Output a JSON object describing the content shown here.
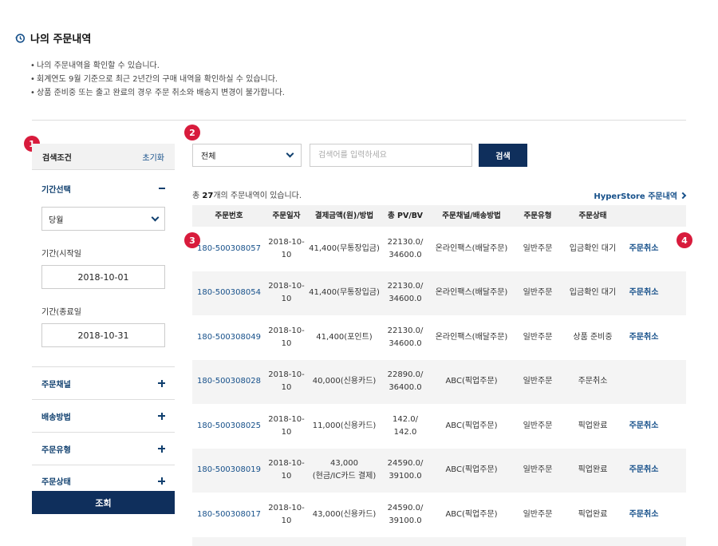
{
  "page": {
    "title": "나의 주문내역",
    "notes": [
      "나의 주문내역을 확인할 수 있습니다.",
      "회계연도 9월 기준으로 최근 2년간의 구매 내역을 확인하실 수 있습니다.",
      "상품 준비중 또는 출고 완료의 경우 주문 취소와 배송지 변경이 불가합니다."
    ]
  },
  "badges": [
    "1",
    "2",
    "3",
    "4"
  ],
  "sidebar": {
    "header": "검색조건",
    "reset": "초기화",
    "period_label": "기간선택",
    "period_value": "당월",
    "start_label": "기간(시작일",
    "start_date": "2018-10-01",
    "end_label": "기간(종료일",
    "end_date": "2018-10-31",
    "accordions": [
      "주문채널",
      "배송방법",
      "주문유형",
      "주문상태"
    ],
    "submit": "조회"
  },
  "search": {
    "select": "전체",
    "placeholder": "검색어를 입력하세요",
    "button": "검색"
  },
  "summary": {
    "prefix": "총 ",
    "count": "27",
    "suffix": "개의 주문내역이 있습니다.",
    "hyperstore": "HyperStore 주문내역"
  },
  "table": {
    "headers": [
      "주문번호",
      "주문일자",
      "결제금액(원)/방법",
      "총 PV/BV",
      "주문채널/배송방법",
      "주문유형",
      "주문상태",
      ""
    ],
    "rows": [
      {
        "no": "180-500308057",
        "date": "2018-10-10",
        "pay1": "41,400(무통장입금)",
        "pay2": "",
        "pv": "22130.0/",
        "bv": "34600.0",
        "channel": "온라인팩스(배달주문)",
        "type": "일반주문",
        "status": "입금확인 대기",
        "action": "주문취소"
      },
      {
        "no": "180-500308054",
        "date": "2018-10-10",
        "pay1": "41,400(무통장입금)",
        "pay2": "",
        "pv": "22130.0/",
        "bv": "34600.0",
        "channel": "온라인팩스(배달주문)",
        "type": "일반주문",
        "status": "입금확인 대기",
        "action": "주문취소"
      },
      {
        "no": "180-500308049",
        "date": "2018-10-10",
        "pay1": "41,400(포인트)",
        "pay2": "",
        "pv": "22130.0/",
        "bv": "34600.0",
        "channel": "온라인팩스(배달주문)",
        "type": "일반주문",
        "status": "상품 준비중",
        "action": "주문취소"
      },
      {
        "no": "180-500308028",
        "date": "2018-10-10",
        "pay1": "40,000(신용카드)",
        "pay2": "",
        "pv": "22890.0/",
        "bv": "36400.0",
        "channel": "ABC(픽업주문)",
        "type": "일반주문",
        "status": "주문취소",
        "action": ""
      },
      {
        "no": "180-500308025",
        "date": "2018-10-10",
        "pay1": "11,000(신용카드)",
        "pay2": "",
        "pv": "142.0/",
        "bv": "142.0",
        "channel": "ABC(픽업주문)",
        "type": "일반주문",
        "status": "픽업완료",
        "action": "주문취소"
      },
      {
        "no": "180-500308019",
        "date": "2018-10-10",
        "pay1": "43,000",
        "pay2": "(현금/IC카드 결제)",
        "pv": "24590.0/",
        "bv": "39100.0",
        "channel": "ABC(픽업주문)",
        "type": "일반주문",
        "status": "픽업완료",
        "action": "주문취소"
      },
      {
        "no": "180-500308017",
        "date": "2018-10-10",
        "pay1": "43,000(신용카드)",
        "pay2": "",
        "pv": "24590.0/",
        "bv": "39100.0",
        "channel": "ABC(픽업주문)",
        "type": "일반주문",
        "status": "픽업완료",
        "action": "주문취소"
      }
    ]
  }
}
